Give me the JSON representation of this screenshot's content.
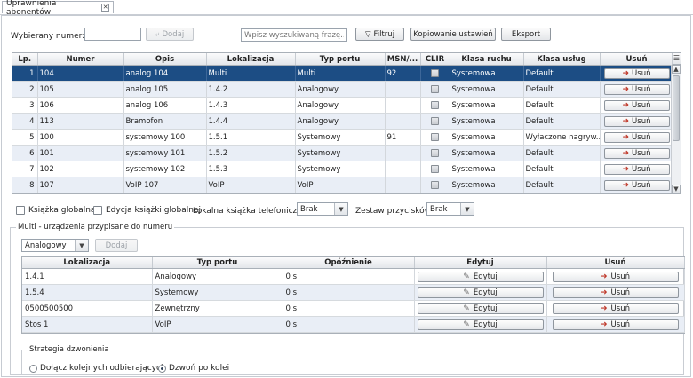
{
  "tab": {
    "title": "Uprawnienia abonentów"
  },
  "toolbar": {
    "number_label": "Wybierany numer:",
    "number_value": "",
    "add_label": "Dodaj",
    "search_placeholder": "Wpisz wyszukiwaną frazę...",
    "filter_label": "Filtruj",
    "copy_label": "Kopiowanie ustawień",
    "export_label": "Eksport"
  },
  "main_table": {
    "columns": [
      "Lp.",
      "Numer",
      "Opis",
      "Lokalizacja",
      "Typ portu",
      "MSN/...",
      "CLIR",
      "Klasa ruchu",
      "Klasa usług",
      "Usuń"
    ],
    "delete_label": "Usuń",
    "rows": [
      {
        "lp": "1",
        "numer": "104",
        "opis": "analog 104",
        "lok": "Multi",
        "typ": "Multi",
        "msn": "92",
        "klasa_ruchu": "Systemowa",
        "klasa_uslug": "Default",
        "selected": true
      },
      {
        "lp": "2",
        "numer": "105",
        "opis": "analog 105",
        "lok": "1.4.2",
        "typ": "Analogowy",
        "msn": "",
        "klasa_ruchu": "Systemowa",
        "klasa_uslug": "Default"
      },
      {
        "lp": "3",
        "numer": "106",
        "opis": "analog 106",
        "lok": "1.4.3",
        "typ": "Analogowy",
        "msn": "",
        "klasa_ruchu": "Systemowa",
        "klasa_uslug": "Default"
      },
      {
        "lp": "4",
        "numer": "113",
        "opis": "Bramofon",
        "lok": "1.4.4",
        "typ": "Analogowy",
        "msn": "",
        "klasa_ruchu": "Systemowa",
        "klasa_uslug": "Default"
      },
      {
        "lp": "5",
        "numer": "100",
        "opis": "systemowy 100",
        "lok": "1.5.1",
        "typ": "Systemowy",
        "msn": "91",
        "klasa_ruchu": "Systemowa",
        "klasa_uslug": "Wyłaczone nagryw..."
      },
      {
        "lp": "6",
        "numer": "101",
        "opis": "systemowy 101",
        "lok": "1.5.2",
        "typ": "Systemowy",
        "msn": "",
        "klasa_ruchu": "Systemowa",
        "klasa_uslug": "Default"
      },
      {
        "lp": "7",
        "numer": "102",
        "opis": "systemowy 102",
        "lok": "1.5.3",
        "typ": "Systemowy",
        "msn": "",
        "klasa_ruchu": "Systemowa",
        "klasa_uslug": "Default"
      },
      {
        "lp": "8",
        "numer": "107",
        "opis": "VoIP 107",
        "lok": "VoIP",
        "typ": "VoIP",
        "msn": "",
        "klasa_ruchu": "Systemowa",
        "klasa_uslug": "Default"
      }
    ]
  },
  "options": {
    "global_book_label": "Książka globalna",
    "edit_global_book_label": "Edycja książki globalnej",
    "local_book_label": "Lokalna książka telefoniczna",
    "local_book_value": "Brak",
    "key_set_label": "Zestaw przycisków",
    "key_set_value": "Brak"
  },
  "multi": {
    "legend": "Multi - urządzenia przypisane do numeru",
    "type_value": "Analogowy",
    "add_label": "Dodaj",
    "columns": [
      "Lokalizacja",
      "Typ portu",
      "Opóźnienie",
      "Edytuj",
      "Usuń"
    ],
    "edit_label": "Edytuj",
    "delete_label": "Usuń",
    "rows": [
      {
        "lok": "1.4.1",
        "typ": "Analogowy",
        "opoz": "0 s"
      },
      {
        "lok": "1.5.4",
        "typ": "Systemowy",
        "opoz": "0 s"
      },
      {
        "lok": "0500500500",
        "typ": "Zewnętrzny",
        "opoz": "0 s"
      },
      {
        "lok": "Stos 1",
        "typ": "VoIP",
        "opoz": "0 s"
      }
    ]
  },
  "strategy": {
    "legend": "Strategia dzwonienia",
    "option_1": "Dołącz kolejnych odbierających",
    "option_2": "Dzwoń po kolei",
    "selected": "option_2"
  }
}
